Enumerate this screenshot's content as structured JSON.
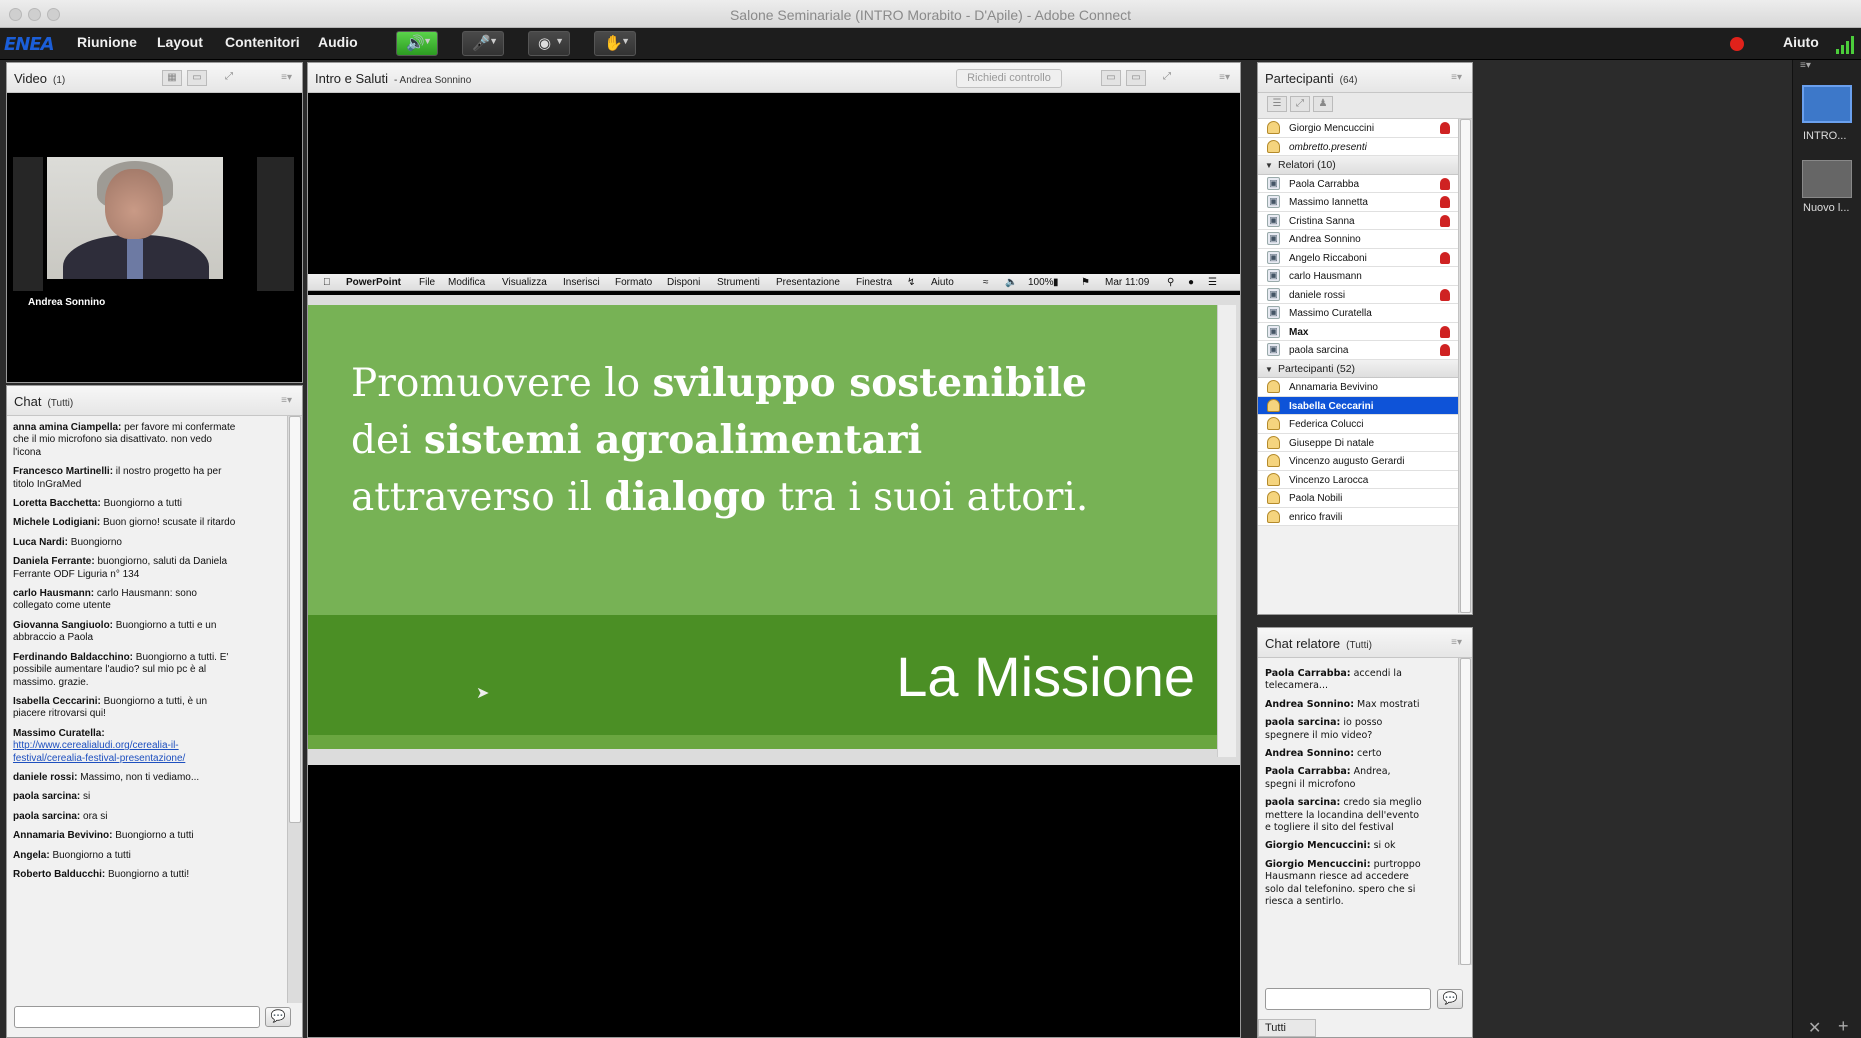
{
  "window": {
    "title": "Salone Seminariale (INTRO Morabito - D'Apile) - Adobe Connect"
  },
  "menubar": {
    "logo": "ENEA",
    "items": [
      "Riunione",
      "Layout",
      "Contenitori",
      "Audio"
    ],
    "help": "Aiuto",
    "speaker_icon": "speaker-icon",
    "mic_icon": "microphone-icon",
    "camera_icon": "webcam-icon",
    "raise_hand_icon": "raise-hand-icon"
  },
  "video_pod": {
    "title": "Video",
    "count": "(1)",
    "cam_name": "Andrea Sonnino"
  },
  "share_pod": {
    "title": "Intro e Saluti",
    "presenter": "- Andrea Sonnino",
    "request_control": "Richiedi controllo",
    "mac_menu": {
      "app": "PowerPoint",
      "items": [
        "File",
        "Modifica",
        "Visualizza",
        "Inserisci",
        "Formato",
        "Disponi",
        "Strumenti",
        "Presentazione",
        "Finestra",
        "Aiuto"
      ],
      "battery": "100%",
      "clock": "Mar 11:09"
    },
    "slide": {
      "line1_pre": "Promuovere lo ",
      "line1_bold": "sviluppo sostenibile",
      "line2_pre": "dei ",
      "line2_bold": "sistemi agroalimentari",
      "line3_pre": "attraverso il ",
      "line3_bold": "dialogo",
      "line3_post": " tra i suoi attori.",
      "title": "La Missione"
    }
  },
  "chat_pod": {
    "title": "Chat",
    "scope": "(Tutti)",
    "messages": [
      {
        "author": "anna amina Ciampella:",
        "text": " per favore mi confermate che il mio microfono sia disattivato. non vedo l'icona"
      },
      {
        "author": "Francesco Martinelli:",
        "text": " il nostro progetto ha per titolo InGraMed"
      },
      {
        "author": "Loretta Bacchetta:",
        "text": " Buongiorno a tutti"
      },
      {
        "author": "Michele Lodigiani:",
        "text": " Buon giorno! scusate il ritardo"
      },
      {
        "author": "Luca Nardi:",
        "text": " Buongiorno"
      },
      {
        "author": "Daniela Ferrante:",
        "text": " buongiorno, saluti da Daniela Ferrante ODF Liguria  n° 134"
      },
      {
        "author": "carlo Hausmann:",
        "text": " carlo Hausmann: sono collegato come utente"
      },
      {
        "author": "Giovanna Sangiuolo:",
        "text": " Buongiorno a tutti e un abbraccio a Paola"
      },
      {
        "author": "Ferdinando Baldacchino:",
        "text": " Buongiorno a tutti.  E' possibile aumentare l'audio? sul mio pc è al massimo. grazie."
      },
      {
        "author": "Isabella Ceccarini:",
        "text": " Buongiorno a tutti, è un piacere ritrovarsi qui!"
      },
      {
        "author": "Massimo Curatella:",
        "text": "",
        "link": "http://www.cerealialudi.org/cerealia-il-festival/cerealia-festival-presentazione/"
      },
      {
        "author": "daniele rossi:",
        "text": " Massimo, non ti vediamo..."
      },
      {
        "author": "paola sarcina:",
        "text": " si"
      },
      {
        "author": "paola sarcina:",
        "text": " ora si"
      },
      {
        "author": "Annamaria Bevivino:",
        "text": " Buongiorno a tutti"
      },
      {
        "author": "Angela:",
        "text": " Buongiorno a tutti"
      },
      {
        "author": "Roberto Balducchi:",
        "text": " Buongiorno a tutti!"
      }
    ]
  },
  "participants_pod": {
    "title": "Partecipanti",
    "count": "(64)",
    "hosts": [
      {
        "name": "Giorgio Mencuccini",
        "mic": true,
        "style": ""
      },
      {
        "name": "ombretto.presenti",
        "mic": false,
        "style": "italic"
      }
    ],
    "presenters_group": "Relatori (10)",
    "presenters": [
      {
        "name": "Paola Carrabba",
        "mic": true,
        "style": ""
      },
      {
        "name": "Massimo Iannetta",
        "mic": true,
        "style": ""
      },
      {
        "name": "Cristina Sanna",
        "mic": true,
        "style": ""
      },
      {
        "name": "Andrea Sonnino",
        "mic": false,
        "style": ""
      },
      {
        "name": "Angelo Riccaboni",
        "mic": true,
        "style": ""
      },
      {
        "name": "carlo Hausmann",
        "mic": false,
        "style": ""
      },
      {
        "name": "daniele rossi",
        "mic": true,
        "style": ""
      },
      {
        "name": "Massimo Curatella",
        "mic": false,
        "style": ""
      },
      {
        "name": "Max",
        "mic": true,
        "style": "bold"
      },
      {
        "name": "paola sarcina",
        "mic": true,
        "style": ""
      }
    ],
    "participants_group": "Partecipanti (52)",
    "participants": [
      {
        "name": "Annamaria Bevivino",
        "selected": false
      },
      {
        "name": "Isabella Ceccarini",
        "selected": true
      },
      {
        "name": "Federica Colucci",
        "selected": false
      },
      {
        "name": "Giuseppe Di natale",
        "selected": false
      },
      {
        "name": "Vincenzo augusto Gerardi",
        "selected": false
      },
      {
        "name": "Vincenzo Larocca",
        "selected": false
      },
      {
        "name": "Paola Nobili",
        "selected": false
      },
      {
        "name": "enrico fravili",
        "selected": false
      }
    ]
  },
  "presenter_chat": {
    "title": "Chat relatore",
    "scope": "(Tutti)",
    "tab": "Tutti",
    "messages": [
      {
        "author": "Paola Carrabba:",
        "text": " accendi la telecamera..."
      },
      {
        "author": "Andrea Sonnino:",
        "text": " Max mostrati"
      },
      {
        "author": "paola sarcina:",
        "text": " io posso spegnere il mio video?"
      },
      {
        "author": "Andrea Sonnino:",
        "text": " certo"
      },
      {
        "author": "Paola Carrabba:",
        "text": " Andrea, spegni il microfono"
      },
      {
        "author": "paola sarcina:",
        "text": " credo sia meglio mettere la locandina dell'evento e togliere il sito del festival"
      },
      {
        "author": "Giorgio Mencuccini:",
        "text": " si ok"
      },
      {
        "author": "Giorgio Mencuccini:",
        "text": " purtroppo Hausmann riesce ad accedere solo dal telefonino. spero che si riesca a sentirlo."
      }
    ]
  },
  "layouts_strip": {
    "items": [
      "INTRO...",
      "Nuovo l..."
    ]
  }
}
